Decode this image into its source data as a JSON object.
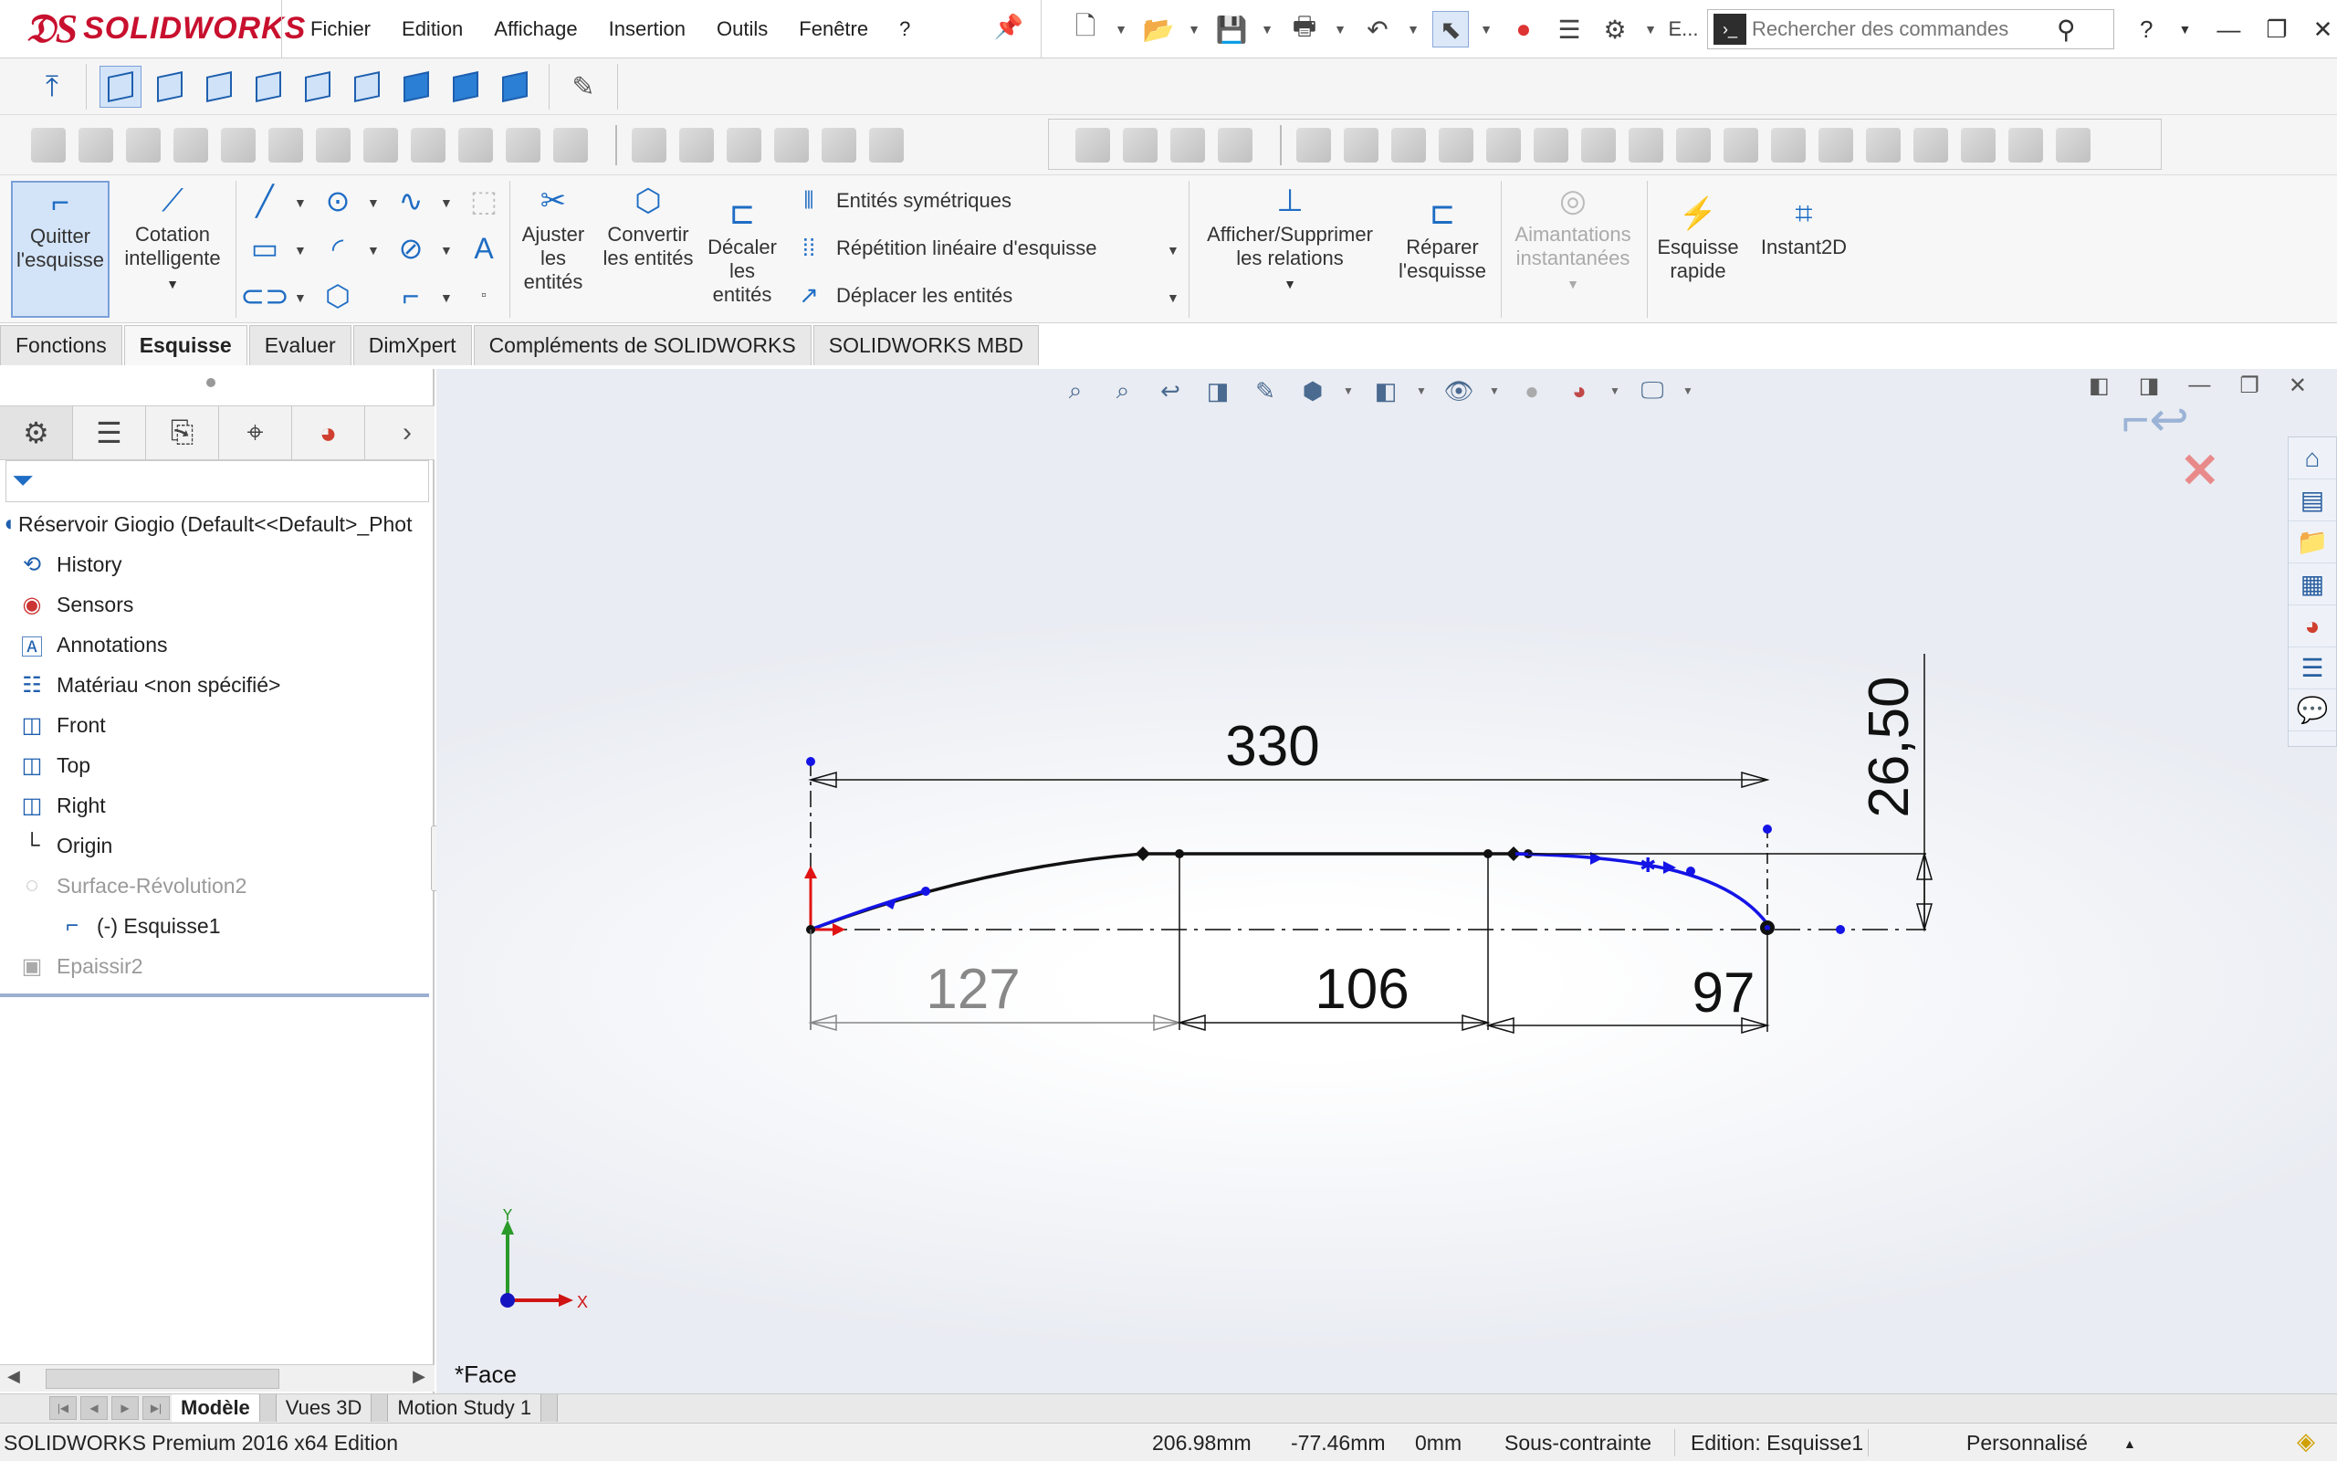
{
  "app": {
    "brand": "SOLIDWORKS"
  },
  "menu": [
    "Fichier",
    "Edition",
    "Affichage",
    "Insertion",
    "Outils",
    "Fenêtre",
    "?"
  ],
  "quick_access": {
    "extra_label": "E..."
  },
  "search": {
    "placeholder": "Rechercher des commandes"
  },
  "ribbon": {
    "exit_sketch": "Quitter l'esquisse",
    "smart_dimension": "Cotation intelligente",
    "trim": "Ajuster les entités",
    "convert": "Convertir les entités",
    "offset": "Décaler les entités",
    "mirror": "Entités symétriques",
    "linear_pattern": "Répétition linéaire d'esquisse",
    "move": "Déplacer les entités",
    "relations": "Afficher/Supprimer les relations",
    "repair": "Réparer l'esquisse",
    "snaps": "Aimantations instantanées",
    "rapid_sketch": "Esquisse rapide",
    "instant2d": "Instant2D"
  },
  "tabs": [
    "Fonctions",
    "Esquisse",
    "Evaluer",
    "DimXpert",
    "Compléments de SOLIDWORKS",
    "SOLIDWORKS MBD"
  ],
  "active_tab": "Esquisse",
  "tree": {
    "root": "Réservoir Giogio  (Default<<Default>_Phot",
    "items": [
      {
        "label": "History",
        "icon": "history-icon"
      },
      {
        "label": "Sensors",
        "icon": "sensor-icon"
      },
      {
        "label": "Annotations",
        "icon": "annotation-icon"
      },
      {
        "label": "Matériau <non spécifié>",
        "icon": "material-icon"
      },
      {
        "label": "Front",
        "icon": "plane-icon"
      },
      {
        "label": "Top",
        "icon": "plane-icon"
      },
      {
        "label": "Right",
        "icon": "plane-icon"
      },
      {
        "label": "Origin",
        "icon": "origin-icon"
      },
      {
        "label": "Surface-Révolution2",
        "icon": "surface-revolve-icon"
      },
      {
        "label": "(-) Esquisse1",
        "icon": "sketch-icon"
      },
      {
        "label": "Epaissir2",
        "icon": "thicken-icon"
      }
    ]
  },
  "graphics": {
    "dimensions": {
      "total": "330",
      "height": "26,50",
      "seg1": "127",
      "seg2": "106",
      "seg3": "97"
    },
    "triad": {
      "x": "X",
      "y": "Y"
    },
    "face_label": "*Face",
    "colors": {
      "sketch_blue": "#1414e6",
      "dimension": "#111111",
      "driven_dimension": "#888888"
    }
  },
  "bottom_tabs": [
    "Modèle",
    "Vues 3D",
    "Motion Study 1"
  ],
  "active_bottom_tab": "Modèle",
  "status": {
    "product": "SOLIDWORKS Premium 2016 x64 Edition",
    "x": "206.98mm",
    "y": "-77.46mm",
    "z": "0mm",
    "state": "Sous-contrainte",
    "editing": "Edition: Esquisse1",
    "units": "Personnalisé"
  }
}
